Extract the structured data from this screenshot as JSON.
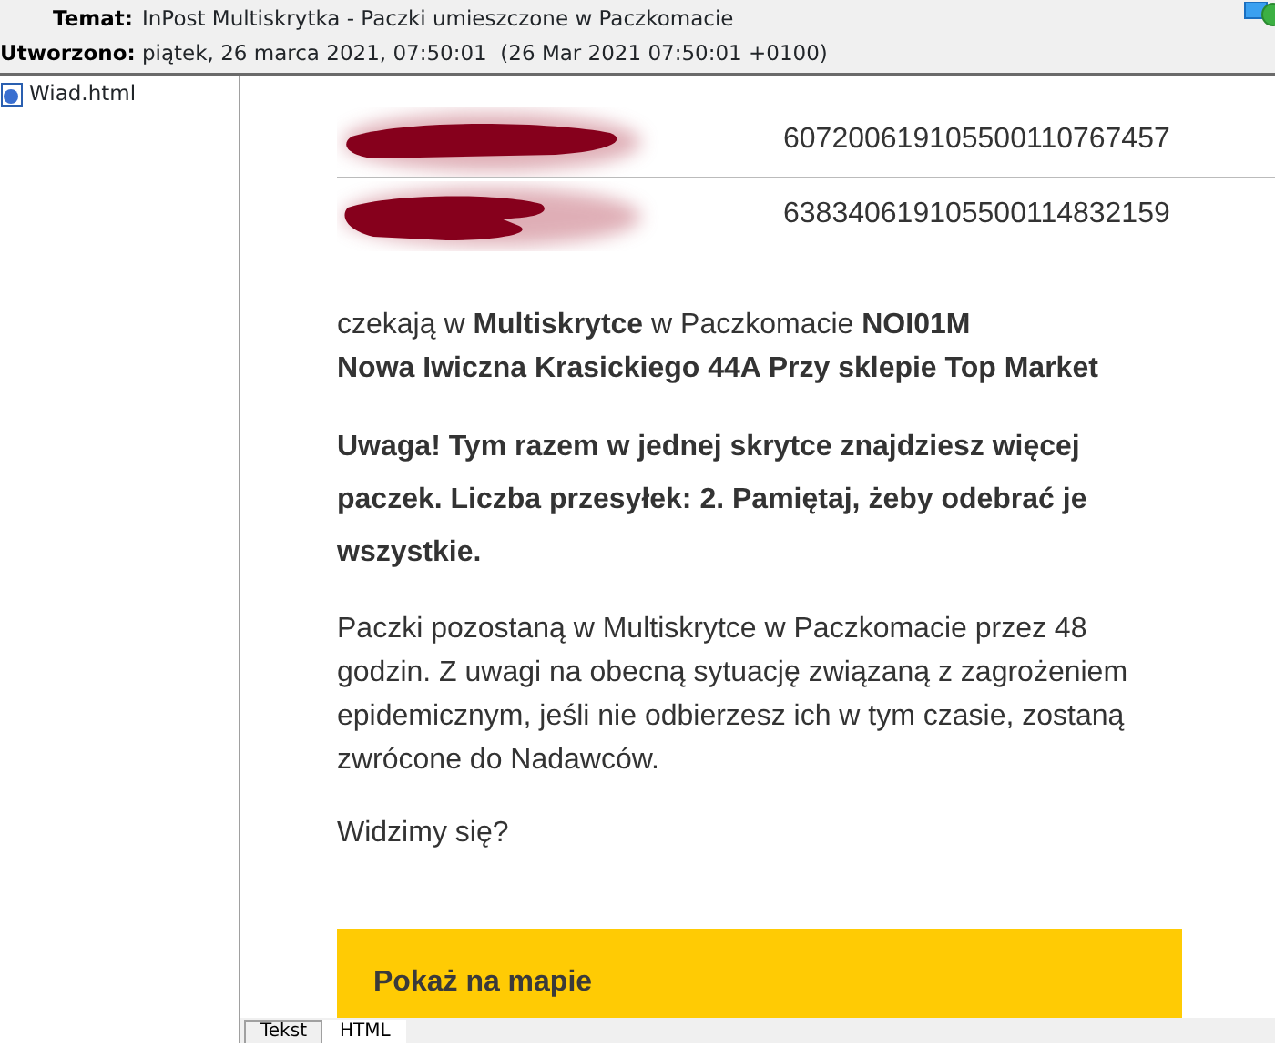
{
  "header": {
    "fields": [
      {
        "label": "Temat:",
        "value": "InPost Multiskrytka - Paczki umieszczone w Paczkomacie"
      },
      {
        "label": "Utworzono:",
        "value": "piątek, 26 marca 2021, 07:50:01  (26 Mar 2021 07:50:01 +0100)"
      }
    ]
  },
  "attachments": [
    {
      "name": "Wiad.html"
    }
  ],
  "message": {
    "parcels": [
      {
        "number": "607200619105500110767457"
      },
      {
        "number": "638340619105500114832159"
      }
    ],
    "paragraphs": [
      {
        "bold": false,
        "lines": [
          "czekają w **Multiskrytce** w Paczkomacie **NOI01M**",
          "**Nowa Iwiczna Krasickiego 44A Przy sklepie Top Market**"
        ]
      },
      {
        "bold": true,
        "lines": [
          "Uwaga! Tym razem w jednej skrytce znajdziesz więcej paczek. Liczba przesyłek: 2. Pamiętaj, żeby odebrać je wszystkie."
        ]
      },
      {
        "bold": false,
        "lines": [
          "Paczki pozostaną w Multiskrytce w Paczkomacie przez 48 godzin. Z uwagi na obecną sytuację związaną z zagrożeniem epidemicznym, jeśli nie odbierzesz ich w tym czasie, zostaną zwrócone do Nadawców."
        ]
      },
      {
        "bold": false,
        "lines": [
          "Widzimy się?"
        ]
      }
    ],
    "button": "Pokaż na mapie"
  },
  "view_tabs": [
    {
      "label": "Tekst",
      "selected": false
    },
    {
      "label": "HTML",
      "selected": true
    }
  ]
}
